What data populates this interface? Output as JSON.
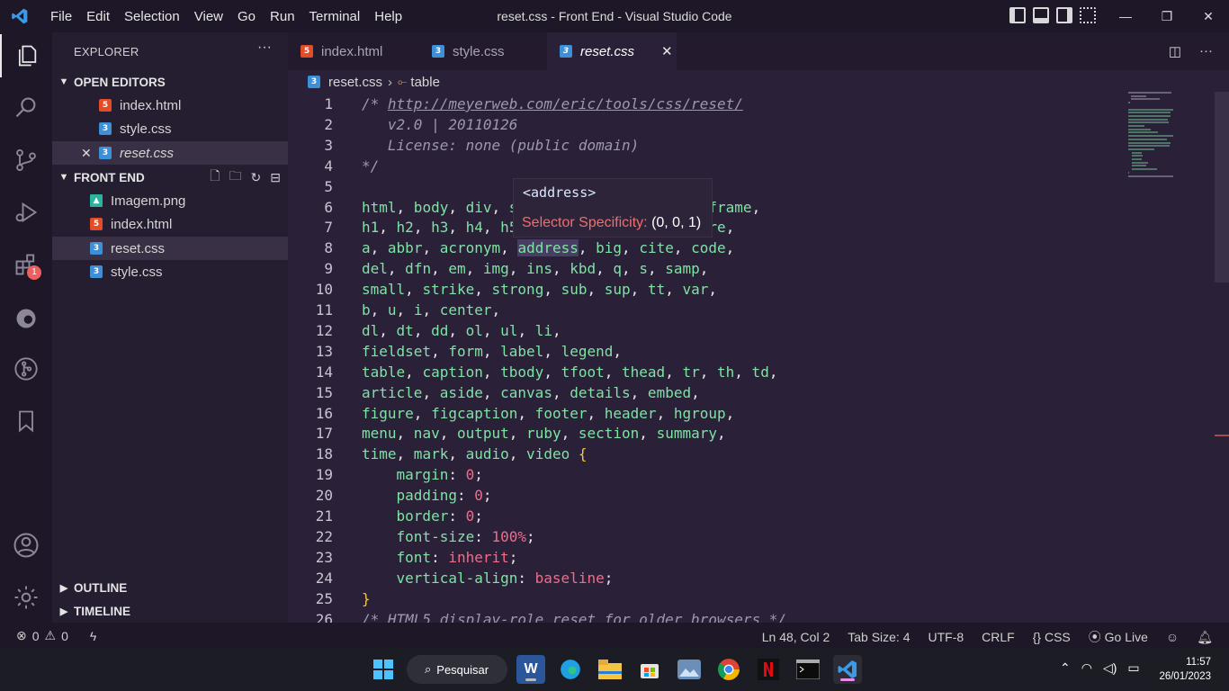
{
  "window": {
    "title": "reset.css - Front End - Visual Studio Code",
    "menu": [
      "File",
      "Edit",
      "Selection",
      "View",
      "Go",
      "Run",
      "Terminal",
      "Help"
    ]
  },
  "activity": {
    "items": [
      "explorer-icon",
      "search-icon",
      "source-control-icon",
      "run-debug-icon",
      "extensions-icon",
      "edge-devtools-icon",
      "git-graph-icon",
      "bookmarks-icon",
      "accounts-icon",
      "settings-gear-icon"
    ],
    "extensions_badge": "1"
  },
  "sidebar": {
    "header": "EXPLORER",
    "more": "···",
    "open_editors": {
      "title": "OPEN EDITORS",
      "items": [
        "index.html",
        "style.css",
        "reset.css"
      ]
    },
    "folder": {
      "title": "FRONT END",
      "items": [
        "Imagem.png",
        "index.html",
        "reset.css",
        "style.css"
      ]
    },
    "outline": "OUTLINE",
    "timeline": "TIMELINE"
  },
  "tabs": [
    "index.html",
    "style.css",
    "reset.css"
  ],
  "breadcrumb": {
    "file": "reset.css",
    "symbol": "table"
  },
  "code_lines": [
    "/* http://meyerweb.com/eric/tools/css/reset/",
    "   v2.0 | 20110126",
    "   License: none (public domain)",
    "*/",
    "",
    "html, body, div, span, applet, object, iframe,",
    "h1, h2, h3, h4, h5, h6, p, blockquote, pre,",
    "a, abbr, acronym, address, big, cite, code,",
    "del, dfn, em, img, ins, kbd, q, s, samp,",
    "small, strike, strong, sub, sup, tt, var,",
    "b, u, i, center,",
    "dl, dt, dd, ol, ul, li,",
    "fieldset, form, label, legend,",
    "table, caption, tbody, tfoot, thead, tr, th, td,",
    "article, aside, canvas, details, embed,",
    "figure, figcaption, footer, header, hgroup,",
    "menu, nav, output, ruby, section, summary,",
    "time, mark, audio, video {",
    "    margin: 0;",
    "    padding: 0;",
    "    border: 0;",
    "    font-size: 100%;",
    "    font: inherit;",
    "    vertical-align: baseline;",
    "}",
    "/* HTML5 display-role reset for older browsers */"
  ],
  "hover": {
    "element": "<address>",
    "label": "Selector Specificity:",
    "value": "(0, 0, 1)"
  },
  "status": {
    "errors": "0",
    "warnings": "0",
    "position": "Ln 48, Col 2",
    "tab_size": "Tab Size: 4",
    "encoding": "UTF-8",
    "eol": "CRLF",
    "language": "CSS",
    "golive": "Go Live"
  },
  "taskbar": {
    "search": "Pesquisar",
    "time": "11:57",
    "date": "26/01/2023"
  }
}
